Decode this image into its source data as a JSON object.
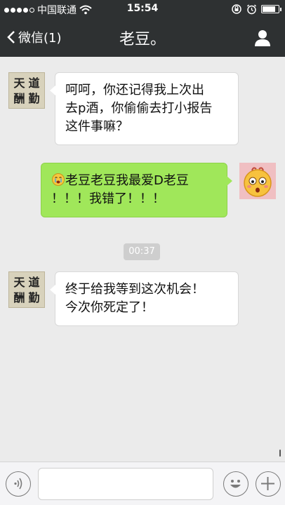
{
  "status_bar": {
    "carrier": "中国联通",
    "time": "15:54",
    "signal_icon": "signal-dots-icon",
    "wifi_icon": "wifi-icon",
    "battery_level": 0.8
  },
  "nav": {
    "back_label": "微信(1)",
    "title": "老豆。",
    "profile_icon": "person-icon"
  },
  "messages": [
    {
      "direction": "in",
      "avatar_text": [
        "天",
        "道",
        "酬",
        "勤"
      ],
      "lines": [
        "呵呵，你还记得我上次出",
        "去p酒，你偷偷去打小报告",
        "这件事嘛？"
      ]
    },
    {
      "direction": "out",
      "emoji_icon": "crying-face-icon",
      "lines": [
        "老豆老豆我最爱D老豆",
        "！！！我错了！！！"
      ]
    },
    {
      "direction": "in",
      "avatar_text": [
        "天",
        "道",
        "酬",
        "勤"
      ],
      "lines": [
        "终于给我等到这次机会！",
        "今次你死定了！"
      ]
    }
  ],
  "timestamp": "00:37",
  "input_bar": {
    "voice_icon": "voice-icon",
    "emoji_icon": "emoji-icon",
    "plus_icon": "plus-icon",
    "text_value": ""
  }
}
